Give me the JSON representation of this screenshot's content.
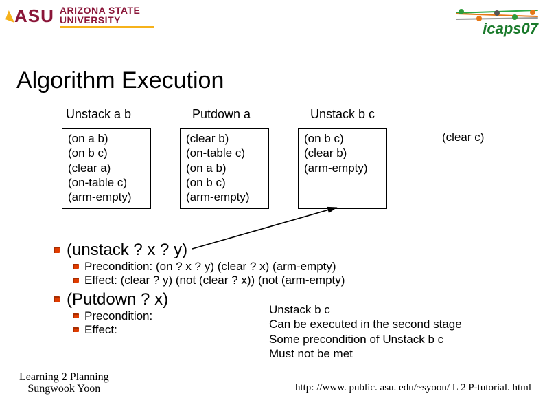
{
  "logos": {
    "asu_letters": "ASU",
    "asu_line1": "ARIZONA STATE",
    "asu_line2": "UNIVERSITY",
    "icaps_text": "icaps07"
  },
  "title": "Algorithm Execution",
  "steps": {
    "s1": "Unstack a b",
    "s2": "Putdown a",
    "s3": "Unstack b c"
  },
  "states": {
    "box1": "(on a b)\n(on b c)\n(clear a)\n(on-table c)\n(arm-empty)",
    "box2": "(clear b)\n(on-table c)\n(on a b)\n(on b c)\n(arm-empty)",
    "box3": "(on b c)\n(clear b)\n(arm-empty)",
    "last": "(clear c)"
  },
  "ops": {
    "unstack_head": "(unstack ? x ? y)",
    "unstack_pre": "Precondition: (on ? x ? y) (clear ? x)  (arm-empty)",
    "unstack_eff": "Effect: (clear ? y) (not (clear ? x)) (not (arm-empty)",
    "putdown_head": "(Putdown ? x)",
    "putdown_pre": "Precondition:",
    "putdown_eff": "Effect:"
  },
  "notes": {
    "n1": "Unstack b c",
    "n2": "Can be executed in the second stage",
    "n3": "Some precondition of Unstack b c",
    "n4": "Must not be met"
  },
  "footer": {
    "left1": "Learning 2 Planning",
    "left2": "Sungwook Yoon",
    "right": "http: //www. public. asu. edu/~syoon/ L 2 P-tutorial. html"
  }
}
